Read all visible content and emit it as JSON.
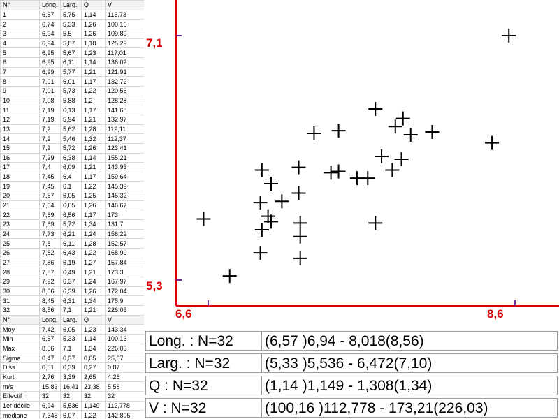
{
  "table": {
    "header": [
      "N°",
      "Long.",
      "Larg.",
      "Q",
      "V"
    ],
    "rows": [
      [
        "1",
        "6,57",
        "5,75",
        "1,14",
        "113,73"
      ],
      [
        "2",
        "6,74",
        "5,33",
        "1,26",
        "100,16"
      ],
      [
        "3",
        "6,94",
        "5,5",
        "1,26",
        "109,89"
      ],
      [
        "4",
        "6,94",
        "5,87",
        "1,18",
        "125,29"
      ],
      [
        "5",
        "6,95",
        "5,67",
        "1,23",
        "117,01"
      ],
      [
        "6",
        "6,95",
        "6,11",
        "1,14",
        "136,02"
      ],
      [
        "7",
        "6,99",
        "5,77",
        "1,21",
        "121,91"
      ],
      [
        "8",
        "7,01",
        "6,01",
        "1,17",
        "132,72"
      ],
      [
        "9",
        "7,01",
        "5,73",
        "1,22",
        "120,56"
      ],
      [
        "10",
        "7,08",
        "5,88",
        "1,2",
        "128,28"
      ],
      [
        "11",
        "7,19",
        "6,13",
        "1,17",
        "141,68"
      ],
      [
        "12",
        "7,19",
        "5,94",
        "1,21",
        "132,97"
      ],
      [
        "13",
        "7,2",
        "5,62",
        "1,28",
        "119,11"
      ],
      [
        "14",
        "7,2",
        "5,46",
        "1,32",
        "112,37"
      ],
      [
        "15",
        "7,2",
        "5,72",
        "1,26",
        "123,41"
      ],
      [
        "16",
        "7,29",
        "6,38",
        "1,14",
        "155,21"
      ],
      [
        "17",
        "7,4",
        "6,09",
        "1,21",
        "143,93"
      ],
      [
        "18",
        "7,45",
        "6,4",
        "1,17",
        "159,64"
      ],
      [
        "19",
        "7,45",
        "6,1",
        "1,22",
        "145,39"
      ],
      [
        "20",
        "7,57",
        "6,05",
        "1,25",
        "145,32"
      ],
      [
        "21",
        "7,64",
        "6,05",
        "1,26",
        "146,67"
      ],
      [
        "22",
        "7,69",
        "6,56",
        "1,17",
        "173"
      ],
      [
        "23",
        "7,69",
        "5,72",
        "1,34",
        "131,7"
      ],
      [
        "24",
        "7,73",
        "6,21",
        "1,24",
        "156,22"
      ],
      [
        "25",
        "7,8",
        "6,11",
        "1,28",
        "152,57"
      ],
      [
        "26",
        "7,82",
        "6,43",
        "1,22",
        "168,99"
      ],
      [
        "27",
        "7,86",
        "6,19",
        "1,27",
        "157,84"
      ],
      [
        "28",
        "7,87",
        "6,49",
        "1,21",
        "173,3"
      ],
      [
        "29",
        "7,92",
        "6,37",
        "1,24",
        "167,97"
      ],
      [
        "30",
        "8,06",
        "6,39",
        "1,26",
        "172,04"
      ],
      [
        "31",
        "8,45",
        "6,31",
        "1,34",
        "175,9"
      ],
      [
        "32",
        "8,56",
        "7,1",
        "1,21",
        "226,03"
      ]
    ],
    "stats_header": [
      "N°",
      "Long.",
      "Larg.",
      "Q",
      "V"
    ],
    "stats": [
      [
        "Moy",
        "7,42",
        "6,05",
        "1,23",
        "143,34"
      ],
      [
        "Min",
        "6,57",
        "5,33",
        "1,14",
        "100,16"
      ],
      [
        "Max",
        "8,56",
        "7,1",
        "1,34",
        "226,03"
      ],
      [
        "Sigma",
        "0,47",
        "0,37",
        "0,05",
        "25,67"
      ],
      [
        "Diss",
        "0,51",
        "0,39",
        "0,27",
        "0,87"
      ],
      [
        "Kurt",
        "2,76",
        "3,39",
        "2,65",
        "4,26"
      ],
      [
        "m/s",
        "15,83",
        "16,41",
        "23,38",
        "5,58"
      ],
      [
        "Effectif =",
        "32",
        "32",
        "32",
        "32"
      ],
      [
        "1er décile",
        "6,94",
        "5,536",
        "1,149",
        "112,778"
      ],
      [
        "médiane",
        "7,345",
        "6,07",
        "1,22",
        "142,805"
      ],
      [
        "9ème décile",
        "8,018",
        "6,472",
        "1,308",
        "173,21"
      ]
    ]
  },
  "chart_data": {
    "type": "scatter",
    "x_var": "Long.",
    "y_var": "Larg.",
    "xlim": [
      6.6,
      8.6
    ],
    "ylim": [
      5.3,
      7.1
    ],
    "xtick_labels": [
      "6,6",
      "8,6"
    ],
    "ytick_labels": [
      "5,3",
      "7,1"
    ],
    "marker": "plus",
    "axis_color": "#d80000",
    "tick_color": "#7030a0",
    "points": [
      [
        6.57,
        5.75
      ],
      [
        6.74,
        5.33
      ],
      [
        6.94,
        5.5
      ],
      [
        6.94,
        5.87
      ],
      [
        6.95,
        5.67
      ],
      [
        6.95,
        6.11
      ],
      [
        6.99,
        5.77
      ],
      [
        7.01,
        6.01
      ],
      [
        7.01,
        5.73
      ],
      [
        7.08,
        5.88
      ],
      [
        7.19,
        6.13
      ],
      [
        7.19,
        5.94
      ],
      [
        7.2,
        5.62
      ],
      [
        7.2,
        5.46
      ],
      [
        7.2,
        5.72
      ],
      [
        7.29,
        6.38
      ],
      [
        7.4,
        6.09
      ],
      [
        7.45,
        6.4
      ],
      [
        7.45,
        6.1
      ],
      [
        7.57,
        6.05
      ],
      [
        7.64,
        6.05
      ],
      [
        7.69,
        6.56
      ],
      [
        7.69,
        5.72
      ],
      [
        7.73,
        6.21
      ],
      [
        7.8,
        6.11
      ],
      [
        7.82,
        6.43
      ],
      [
        7.86,
        6.19
      ],
      [
        7.87,
        6.49
      ],
      [
        7.92,
        6.37
      ],
      [
        8.06,
        6.39
      ],
      [
        8.45,
        6.31
      ],
      [
        8.56,
        7.1
      ]
    ]
  },
  "summary": [
    {
      "name": "Long. : N=32",
      "range": "(6,57 )6,94 - 8,018(8,56)"
    },
    {
      "name": "Larg. : N=32",
      "range": "(5,33 )5,536 - 6,472(7,10)"
    },
    {
      "name": "Q : N=32",
      "range": "(1,14 )1,149 - 1,308(1,34)"
    },
    {
      "name": "V : N=32",
      "range": "(100,16 )112,778 - 173,21(226,03)"
    }
  ]
}
